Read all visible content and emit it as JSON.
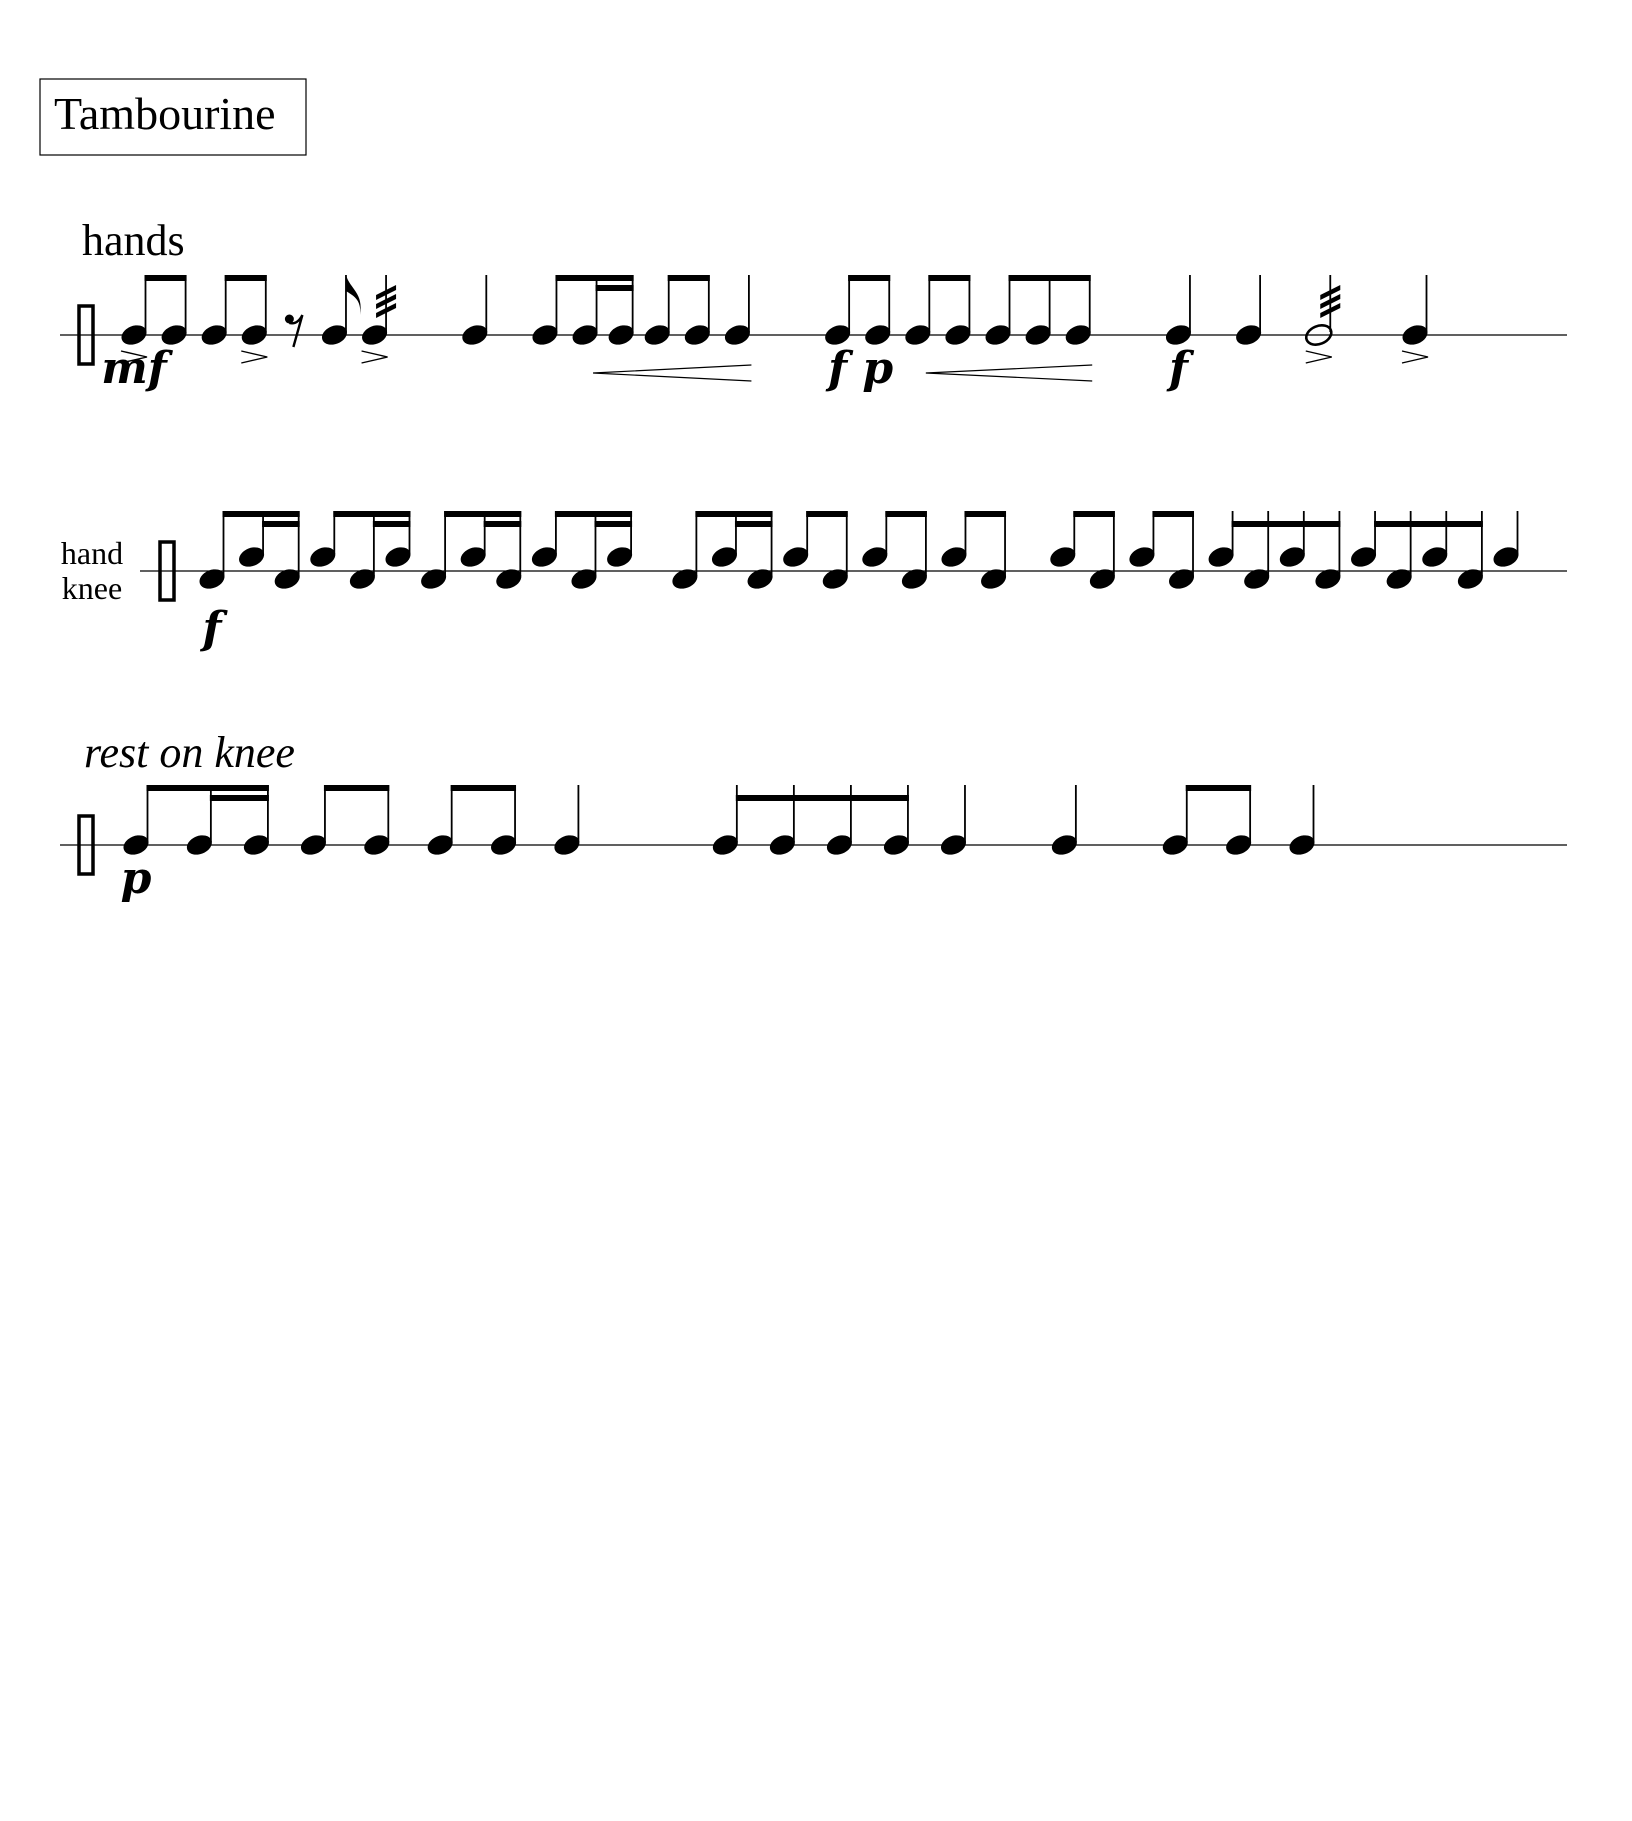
{
  "title": "Tambourine",
  "colors": {
    "ink": "#000000",
    "paper": "#ffffff"
  },
  "systems": [
    {
      "id": "system-1",
      "technique": "hands",
      "technique_style": "upright",
      "notes": [
        {
          "kind": "n",
          "dur": 8,
          "accent": true,
          "dyn": "mf"
        },
        {
          "kind": "n",
          "dur": 8
        },
        {
          "kind": "n",
          "dur": 8
        },
        {
          "kind": "n",
          "dur": 8,
          "accent": true
        },
        {
          "kind": "r",
          "dur": 8
        },
        {
          "kind": "n",
          "dur": 8
        },
        {
          "kind": "n",
          "dur": 4,
          "tremolo": 3,
          "accent": true
        },
        {
          "kind": "n",
          "dur": 4,
          "gap": true
        },
        {
          "kind": "n",
          "dur": 8
        },
        {
          "kind": "n",
          "dur": 16
        },
        {
          "kind": "n",
          "dur": 16
        },
        {
          "kind": "n",
          "dur": 8
        },
        {
          "kind": "n",
          "dur": 8
        },
        {
          "kind": "n",
          "dur": 4
        },
        {
          "kind": "n",
          "dur": 8,
          "gap": true,
          "dyn": "f"
        },
        {
          "kind": "n",
          "dur": 8,
          "dyn": "p"
        },
        {
          "kind": "n",
          "dur": 8
        },
        {
          "kind": "n",
          "dur": 8
        },
        {
          "kind": "n",
          "dur": 8
        },
        {
          "kind": "n",
          "dur": 8
        },
        {
          "kind": "n",
          "dur": 4
        },
        {
          "kind": "n",
          "dur": 4,
          "gap": true,
          "dyn": "f"
        },
        {
          "kind": "n",
          "dur": 4
        },
        {
          "kind": "n",
          "dur": 2,
          "tremolo": 3,
          "accent": true
        },
        {
          "kind": "n",
          "dur": 4,
          "accent": true
        }
      ],
      "beams": [
        [
          0,
          1,
          8
        ],
        [
          2,
          3,
          8
        ],
        [
          8,
          10,
          8
        ],
        [
          9,
          10,
          16
        ],
        [
          11,
          12,
          8
        ],
        [
          14,
          15,
          8
        ],
        [
          16,
          17,
          8
        ],
        [
          18,
          20,
          8
        ]
      ],
      "hairpins": [
        {
          "type": "cresc",
          "from": 9,
          "to": 13
        },
        {
          "type": "cresc",
          "from": 16,
          "to": 20
        }
      ]
    },
    {
      "id": "system-2",
      "label_top": "hand",
      "label_bottom": "knee",
      "notes": [
        {
          "kind": "n",
          "dur": 8,
          "pos": "low",
          "dyn": "f"
        },
        {
          "kind": "n",
          "dur": 16,
          "pos": "high"
        },
        {
          "kind": "n",
          "dur": 16,
          "pos": "low"
        },
        {
          "kind": "n",
          "dur": 8,
          "pos": "high"
        },
        {
          "kind": "n",
          "dur": 16,
          "pos": "low"
        },
        {
          "kind": "n",
          "dur": 16,
          "pos": "high"
        },
        {
          "kind": "n",
          "dur": 8,
          "pos": "low"
        },
        {
          "kind": "n",
          "dur": 16,
          "pos": "high"
        },
        {
          "kind": "n",
          "dur": 16,
          "pos": "low"
        },
        {
          "kind": "n",
          "dur": 8,
          "pos": "high"
        },
        {
          "kind": "n",
          "dur": 16,
          "pos": "low"
        },
        {
          "kind": "n",
          "dur": 16,
          "pos": "high"
        },
        {
          "kind": "n",
          "dur": 8,
          "pos": "low",
          "gap": true
        },
        {
          "kind": "n",
          "dur": 16,
          "pos": "high"
        },
        {
          "kind": "n",
          "dur": 16,
          "pos": "low"
        },
        {
          "kind": "n",
          "dur": 8,
          "pos": "high"
        },
        {
          "kind": "n",
          "dur": 8,
          "pos": "low"
        },
        {
          "kind": "n",
          "dur": 8,
          "pos": "high"
        },
        {
          "kind": "n",
          "dur": 8,
          "pos": "low"
        },
        {
          "kind": "n",
          "dur": 8,
          "pos": "high"
        },
        {
          "kind": "n",
          "dur": 8,
          "pos": "low"
        },
        {
          "kind": "n",
          "dur": 8,
          "pos": "high",
          "gap": true
        },
        {
          "kind": "n",
          "dur": 8,
          "pos": "low"
        },
        {
          "kind": "n",
          "dur": 8,
          "pos": "high"
        },
        {
          "kind": "n",
          "dur": 8,
          "pos": "low"
        },
        {
          "kind": "n",
          "dur": 16,
          "pos": "high"
        },
        {
          "kind": "n",
          "dur": 16,
          "pos": "low"
        },
        {
          "kind": "n",
          "dur": 16,
          "pos": "high"
        },
        {
          "kind": "n",
          "dur": 16,
          "pos": "low"
        },
        {
          "kind": "n",
          "dur": 16,
          "pos": "high"
        },
        {
          "kind": "n",
          "dur": 16,
          "pos": "low"
        },
        {
          "kind": "n",
          "dur": 16,
          "pos": "high"
        },
        {
          "kind": "n",
          "dur": 16,
          "pos": "low"
        },
        {
          "kind": "n",
          "dur": 4,
          "pos": "high"
        }
      ],
      "beams": [
        [
          0,
          2,
          8
        ],
        [
          1,
          2,
          16
        ],
        [
          3,
          5,
          8
        ],
        [
          4,
          5,
          16
        ],
        [
          6,
          8,
          8
        ],
        [
          7,
          8,
          16
        ],
        [
          9,
          11,
          8
        ],
        [
          10,
          11,
          16
        ],
        [
          12,
          14,
          8
        ],
        [
          13,
          14,
          16
        ],
        [
          15,
          16,
          8
        ],
        [
          17,
          18,
          8
        ],
        [
          19,
          20,
          8
        ],
        [
          21,
          22,
          8
        ],
        [
          23,
          24,
          8
        ],
        [
          25,
          28,
          16
        ],
        [
          29,
          32,
          16
        ]
      ],
      "hairpins": []
    },
    {
      "id": "system-3",
      "technique": "rest on knee",
      "technique_style": "italic",
      "notes": [
        {
          "kind": "n",
          "dur": 8,
          "dyn": "p"
        },
        {
          "kind": "n",
          "dur": 16
        },
        {
          "kind": "n",
          "dur": 16
        },
        {
          "kind": "n",
          "dur": 8
        },
        {
          "kind": "n",
          "dur": 8
        },
        {
          "kind": "n",
          "dur": 8
        },
        {
          "kind": "n",
          "dur": 8
        },
        {
          "kind": "n",
          "dur": 4
        },
        {
          "kind": "n",
          "dur": 16,
          "gap": true
        },
        {
          "kind": "n",
          "dur": 16
        },
        {
          "kind": "n",
          "dur": 16
        },
        {
          "kind": "n",
          "dur": 16
        },
        {
          "kind": "n",
          "dur": 4
        },
        {
          "kind": "n",
          "dur": 4
        },
        {
          "kind": "n",
          "dur": 8
        },
        {
          "kind": "n",
          "dur": 8
        },
        {
          "kind": "n",
          "dur": 4
        }
      ],
      "beams": [
        [
          0,
          2,
          8
        ],
        [
          1,
          2,
          16
        ],
        [
          3,
          4,
          8
        ],
        [
          5,
          6,
          8
        ],
        [
          8,
          11,
          16
        ],
        [
          14,
          15,
          8
        ]
      ],
      "hairpins": []
    }
  ]
}
